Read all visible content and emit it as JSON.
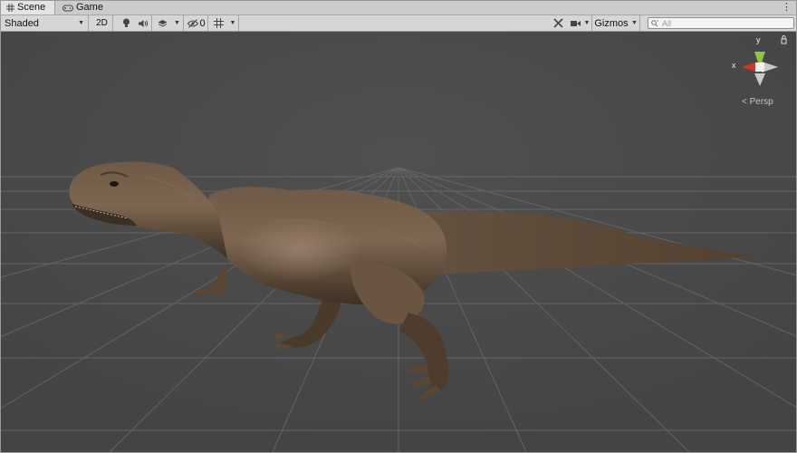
{
  "tabs": [
    {
      "label": "Scene",
      "icon": "grid-icon",
      "active": true
    },
    {
      "label": "Game",
      "icon": "gamepad-icon",
      "active": false
    }
  ],
  "toolbar": {
    "shading_mode": "Shaded",
    "mode_2d_label": "2D",
    "hidden_count": "0",
    "gizmos_label": "Gizmos",
    "search_placeholder": "All"
  },
  "gizmo": {
    "x_label": "x",
    "y_label": "y",
    "projection_label": "Persp"
  },
  "colors": {
    "viewport_background": "#474747",
    "grid_line": "#6a6a6a",
    "x_axis": "#d8341f",
    "y_axis": "#8ec63f",
    "z_axis": "#c9c9c9"
  }
}
